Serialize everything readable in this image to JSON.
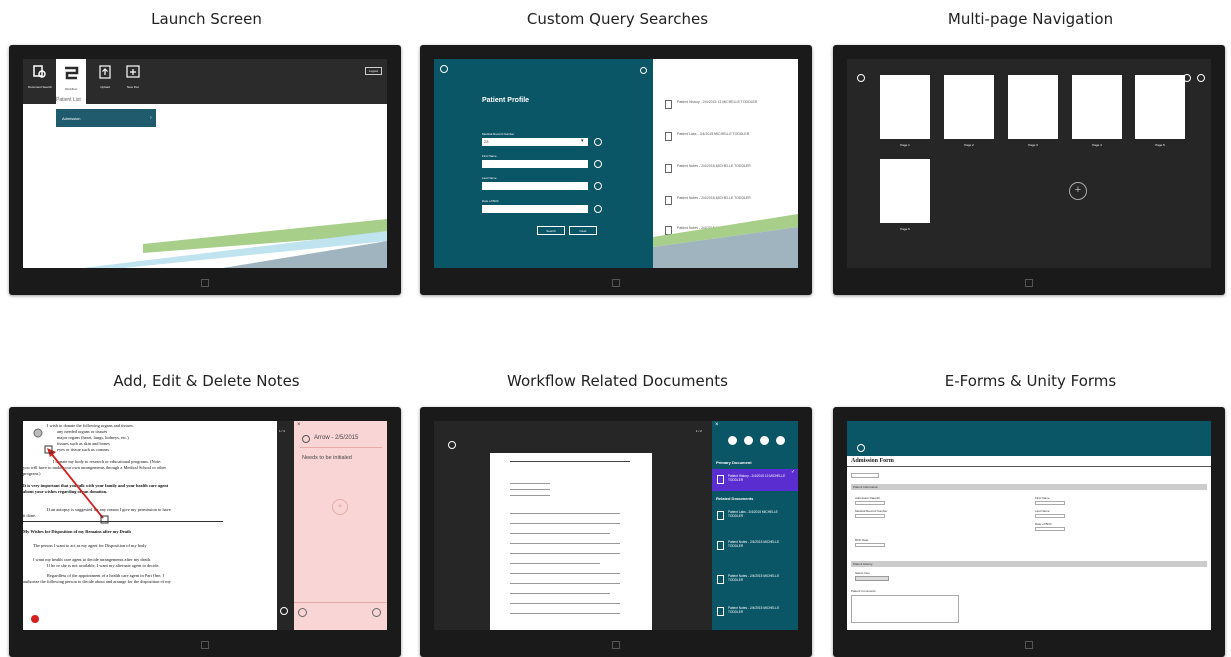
{
  "panels": {
    "launch": {
      "title": "Launch Screen",
      "toolbar": [
        "Document Search",
        "Workflow",
        "Upload",
        "New Doc"
      ],
      "logout": "Logout",
      "list_title": "Patient List",
      "list_item": "Admission"
    },
    "query": {
      "title": "Custom Query Searches",
      "form_title": "Patient Profile",
      "fields": [
        "Medical Record Number",
        "First Name",
        "Last Name",
        "Date of Birth"
      ],
      "mrn_value": "23",
      "search_btn": "Search",
      "clear_btn": "Clear",
      "results": [
        "Patient History - 2/4/2015 13 MICHELLE TODDLER",
        "Patient Labs - 2/4/2015 MICHELLE TODDLER",
        "Patient Notes - 2/4/2015 MICHELLE TODDLER",
        "Patient Notes - 2/4/2015 MICHELLE TODDLER",
        "Patient Notes - 2/4/2015 MICHELLE TODDLER"
      ]
    },
    "multipage": {
      "title": "Multi-page Navigation",
      "pages": [
        "Page 1",
        "Page 2",
        "Page 3",
        "Page 4",
        "Page 5",
        "Page 6"
      ],
      "add_icon": "+"
    },
    "notes": {
      "title": "Add, Edit & Delete Notes",
      "note_header": "Arrow - 2/5/2015",
      "note_text": "Needs to be initialed",
      "page_counter": "1 / 4",
      "doc_lines": [
        "I wish to donate the following organs and tissues",
        "any needed organs or tissues",
        "major organs (heart, lungs, kidneys, etc.)",
        "tissues such as skin and bones",
        "eyes or tissue such as corneas",
        "I donate my body to research or educational programs. (Note:",
        "you will have to make your own arrangements through a Medical School or other",
        "program.)",
        "It is very important that you talk with your family and your health care agent",
        "about your wishes regarding organ donation.",
        "If an autopsy is suggested for any reason I give my permission to have",
        "it done.",
        "My Wishes for Disposition of my Remains after my Death",
        "The person I want to act as my agent for Disposition of my body",
        "I want my health care agent to decide arrangements after my death.",
        "If he or she is not available, I want my alternate agent to decide.",
        "Regardless of the appointment of a health care agent in Part One, I",
        "authorize the following person to decide about and arrange for the disposition of my"
      ]
    },
    "workflow": {
      "title": "Workflow Related Documents",
      "page_counter": "1 / 2",
      "primary_header": "Primary Document",
      "primary_doc": "Patient History - 2/4/2015 13 MICHELLE TODDLER",
      "related_header": "Related Documents",
      "related": [
        "Patient Labs - 2/4/2015 MICHELLE TODDLER",
        "Patient Notes - 2/4/2015 MICHELLE TODDLER",
        "Patient Notes - 2/4/2015 MICHELLE TODDLER",
        "Patient Notes - 2/4/2015 MICHELLE TODDLER"
      ]
    },
    "eforms": {
      "title": "E-Forms & Unity Forms",
      "form_title": "Admission Form",
      "section1": "Patient Information",
      "fields_left": [
        "Admission Date/ID",
        "Medical Record Number"
      ],
      "fields_right": [
        "First Name",
        "Last Name",
        "Date of Birth"
      ],
      "field_birth": "Birth Date",
      "section2": "Patient History",
      "select_label": "Select One",
      "comments": "Patient Comments"
    }
  },
  "colors": {
    "teal": "#0a5566",
    "purple": "#5a2dd1",
    "green": "#a7cf8a",
    "pink": "#f9d5d5",
    "dark": "#262626"
  }
}
